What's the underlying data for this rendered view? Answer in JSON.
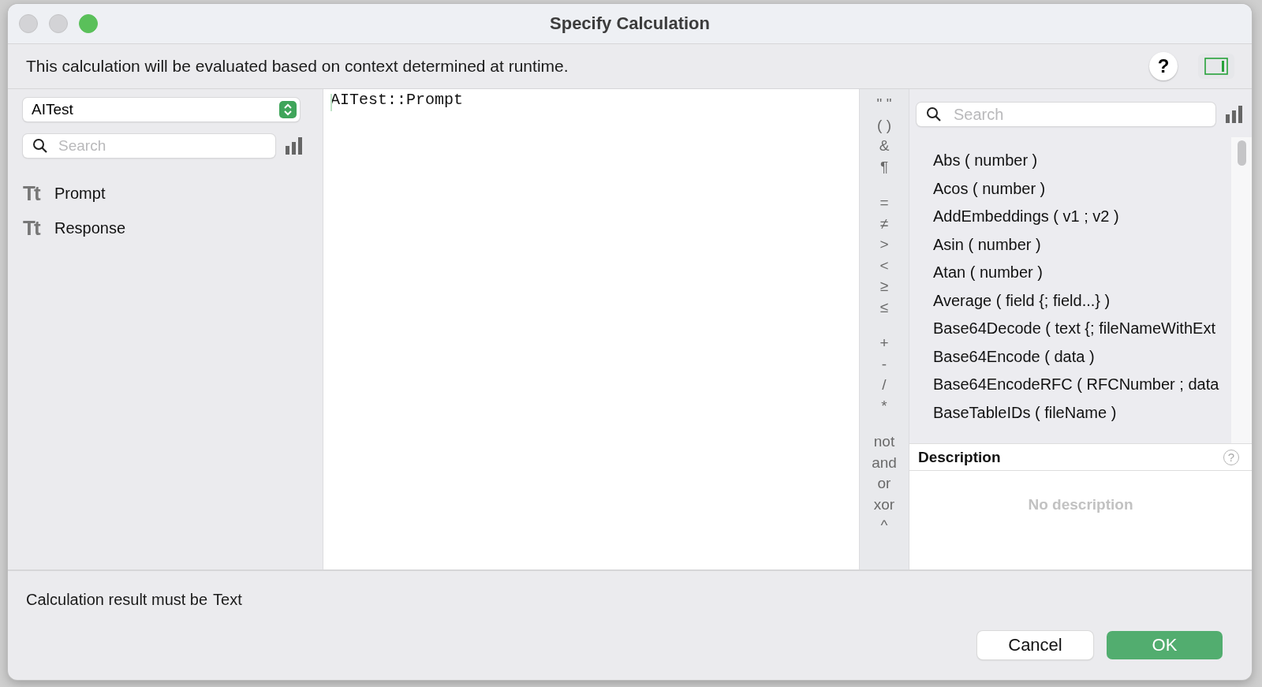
{
  "window": {
    "title": "Specify Calculation",
    "controls": [
      {
        "kind": "close",
        "enabled": false
      },
      {
        "kind": "minimize",
        "enabled": false
      },
      {
        "kind": "zoom",
        "enabled": true
      }
    ]
  },
  "info": {
    "text": "This calculation will be evaluated based on context determined at runtime.",
    "help": "?",
    "sidebar_toggle_on": true
  },
  "fields_panel": {
    "table": "AITest",
    "search": {
      "placeholder": "Search"
    },
    "fields": [
      {
        "type_icon": "Tt",
        "name": "Prompt"
      },
      {
        "type_icon": "Tt",
        "name": "Response"
      }
    ]
  },
  "editor": {
    "formula": "AITest::Prompt"
  },
  "operators": [
    [
      "\" \"",
      "( )",
      "&",
      "¶"
    ],
    [
      "=",
      "≠",
      ">",
      "<",
      "≥",
      "≤"
    ],
    [
      "+",
      "-",
      "/",
      "*"
    ],
    [
      "not",
      "and",
      "or",
      "xor",
      "^"
    ]
  ],
  "functions_panel": {
    "search": {
      "placeholder": "Search"
    },
    "functions": [
      "Abs ( number )",
      "Acos ( number )",
      "AddEmbeddings ( v1 ; v2 )",
      "Asin ( number )",
      "Atan ( number )",
      "Average ( field {; field...} )",
      "Base64Decode ( text {; fileNameWithExt",
      "Base64Encode ( data )",
      "Base64EncodeRFC ( RFCNumber ; data",
      "BaseTableIDs ( fileName )"
    ],
    "description_title": "Description",
    "description_help": "?",
    "description": "No description"
  },
  "footer": {
    "result_label": "Calculation result must be",
    "result_type": "Text",
    "buttons": [
      {
        "label": "Cancel",
        "default": false
      },
      {
        "label": "OK",
        "default": true
      }
    ]
  }
}
